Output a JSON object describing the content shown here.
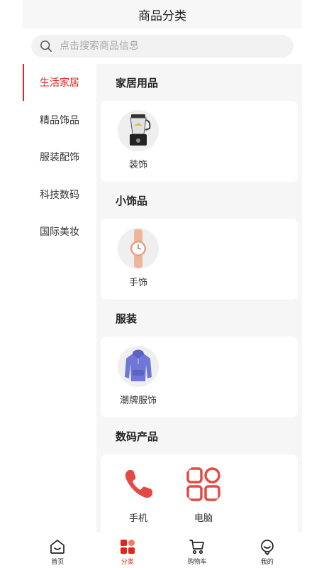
{
  "header": {
    "title": "商品分类"
  },
  "search": {
    "placeholder": "点击搜索商品信息",
    "icon": "search-icon"
  },
  "sidebar": {
    "items": [
      {
        "label": "生活家居",
        "active": true
      },
      {
        "label": "精品饰品",
        "active": false
      },
      {
        "label": "服装配饰",
        "active": false
      },
      {
        "label": "科技数码",
        "active": false
      },
      {
        "label": "国际美妆",
        "active": false
      }
    ]
  },
  "sections": [
    {
      "title": "家居用品",
      "items": [
        {
          "label": "装饰",
          "icon": "blender-image"
        }
      ]
    },
    {
      "title": "小饰品",
      "items": [
        {
          "label": "手饰",
          "icon": "watch-image"
        }
      ]
    },
    {
      "title": "服装",
      "items": [
        {
          "label": "潮牌服饰",
          "icon": "hoodie-image"
        }
      ]
    },
    {
      "title": "数码产品",
      "items": [
        {
          "label": "手机",
          "icon": "phone-icon"
        },
        {
          "label": "电脑",
          "icon": "grid-icon"
        }
      ]
    }
  ],
  "tabbar": {
    "items": [
      {
        "label": "首页",
        "icon": "home-icon",
        "active": false
      },
      {
        "label": "分类",
        "icon": "category-icon",
        "active": true
      },
      {
        "label": "购物车",
        "icon": "cart-icon",
        "active": false
      },
      {
        "label": "我的",
        "icon": "profile-icon",
        "active": false
      }
    ]
  },
  "colors": {
    "accent": "#e0251e",
    "background": "#f6f6f6"
  }
}
